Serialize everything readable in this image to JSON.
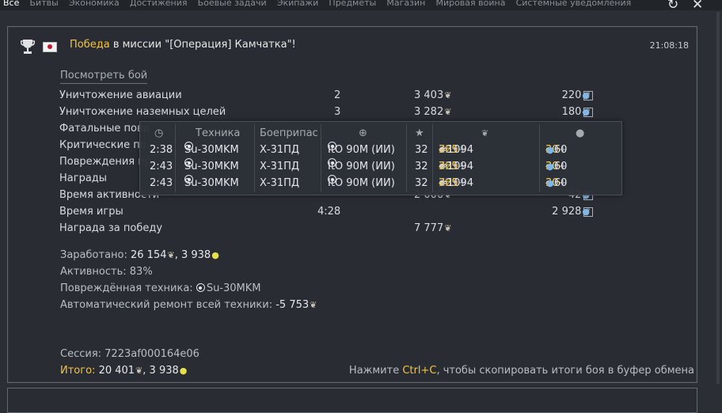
{
  "tabs": [
    "Все",
    "Битвы",
    "Экономика",
    "Достижения",
    "Боевые задачи",
    "Экипажи",
    "Предметы",
    "Магазин",
    "Мировая война",
    "Системные уведомления"
  ],
  "controls": {
    "refresh_icon": "↻",
    "close_icon": "✕"
  },
  "message": {
    "victory": "Победа",
    "mission_text": " в миссии \"[Операция] Камчатка\"!",
    "time": "21:08:18",
    "view_battle": "Посмотреть бой"
  },
  "rows": [
    {
      "label": "Уничтожение авиации",
      "count": "2",
      "silver": "3 403",
      "rp": "220",
      "help": "?"
    },
    {
      "label": "Уничтожение наземных целей",
      "count": "3",
      "silver": "3 282",
      "rp": "180",
      "help": "?"
    },
    {
      "label": "Фатальные повр",
      "count": "",
      "silver": "",
      "rp": "",
      "help": ""
    },
    {
      "label": "Критические по",
      "count": "",
      "silver": "",
      "rp": "",
      "help": ""
    },
    {
      "label": "Повреждения пр",
      "count": "",
      "silver": "",
      "rp": "",
      "help": ""
    },
    {
      "label": "Награды",
      "count": "",
      "silver": "",
      "rp": "",
      "help": ""
    },
    {
      "label": "Время активности",
      "count": "",
      "silver": "2 000",
      "rp": "42",
      "help": "?"
    },
    {
      "label": "Время игры",
      "count": "4:28",
      "silver": "",
      "rp": "2 928",
      "help": "?"
    },
    {
      "label": "Награда за победу",
      "count": "",
      "silver": "7 777",
      "rp": "",
      "help": ""
    }
  ],
  "summary": {
    "earned_label": "Заработано: ",
    "earned_silver": "26 154",
    "earned_rp": "3 938",
    "activity": "Активность: 83%",
    "damaged_label": "Повреждённая техника: ",
    "damaged_vehicle": "Su-30MKM",
    "repair_label": "Автоматический ремонт всей техники: ",
    "repair_value": "-5 753",
    "session": "Сессия: 7223af000164e06",
    "total_label": "Итого:",
    "total_silver": "20 401",
    "total_rp": "3 938"
  },
  "hint": {
    "before": "Нажмите ",
    "key": "Ctrl+C",
    "after": ", чтобы скопировать итоги боя в буфер обмена"
  },
  "tooltip": {
    "headers": {
      "vehicle": "Техника",
      "ammo": "Боеприпас"
    },
    "rows": [
      {
        "time": "2:38",
        "vehicle": "Su-30MKM",
        "ammo": "Х-31ПД",
        "target": "ItO 90M (ИИ)",
        "score": "32",
        "silver_base": "729+",
        "silver_bonus": "365",
        "silver_total": "=1094",
        "rp_base": "30+",
        "rp_bonus": "30",
        "rp_total": "=60"
      },
      {
        "time": "2:43",
        "vehicle": "Su-30MKM",
        "ammo": "Х-31ПД",
        "target": "ItO 90M (ИИ)",
        "score": "32",
        "silver_base": "729+",
        "silver_bonus": "365",
        "silver_total": "=1094",
        "rp_base": "30+",
        "rp_bonus": "30",
        "rp_total": "=60"
      },
      {
        "time": "2:43",
        "vehicle": "Su-30MKM",
        "ammo": "Х-31ПД",
        "target": "ItO 90M (ИИ)",
        "score": "32",
        "silver_base": "729+",
        "silver_bonus": "365",
        "silver_total": "=1094",
        "rp_base": "30+",
        "rp_bonus": "30",
        "rp_total": "=60"
      }
    ]
  },
  "colors": {
    "accent": "#f4c442",
    "rp": "#7eb6ea",
    "bulb": "#e6e04a"
  }
}
